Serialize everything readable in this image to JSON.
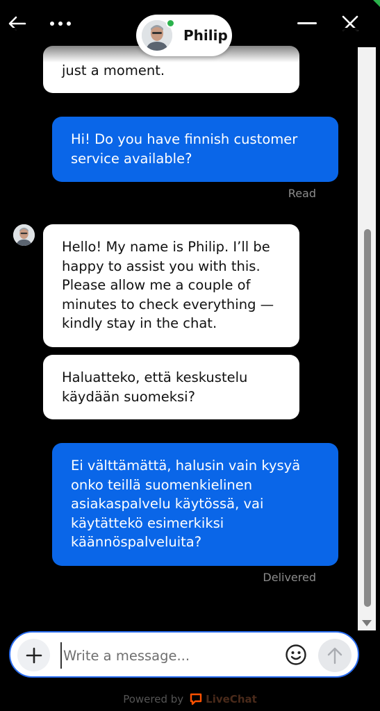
{
  "header": {
    "back_icon": "arrow-left-icon",
    "menu_icon": "more-dots-icon",
    "agent_name": "Philip",
    "agent_status": "online",
    "minimize_icon": "minimize-icon",
    "close_icon": "close-icon"
  },
  "messages": [
    {
      "from": "agent",
      "lines": [
        "just a moment."
      ]
    },
    {
      "from": "user",
      "lines": [
        "Hi! Do you have finnish customer",
        "service available?"
      ],
      "status": "Read"
    },
    {
      "from": "agent",
      "lines": [
        "Hello! My name is Philip. I’ll be",
        "happy to assist you with this.",
        "Please allow me a couple of",
        "minutes to check everything —",
        "kindly stay in the chat."
      ]
    },
    {
      "from": "agent",
      "lines": [
        "Haluatteko, että keskustelu",
        "käydään suomeksi?"
      ]
    },
    {
      "from": "user",
      "lines": [
        "Ei välttämättä, halusin vain kysyä",
        "onko teillä suomenkielinen",
        "asiakaspalvelu käytössä, vai",
        "käytättekö esimerkiksi",
        "käännöspalveluita?"
      ],
      "status": "Delivered"
    }
  ],
  "composer": {
    "placeholder": "Write a message...",
    "value": "",
    "attach_icon": "plus-icon",
    "emoji_icon": "smiley-icon",
    "send_icon": "arrow-up-icon"
  },
  "footer": {
    "powered_by": "Powered by",
    "brand": "LiveChat",
    "brand_icon": "livechat-logo-icon"
  },
  "colors": {
    "background": "#000000",
    "user_bubble": "#0a66e8",
    "agent_bubble": "#ffffff",
    "online": "#2bb24c",
    "composer_border": "#2a6df0",
    "brand": "#ff5100"
  }
}
